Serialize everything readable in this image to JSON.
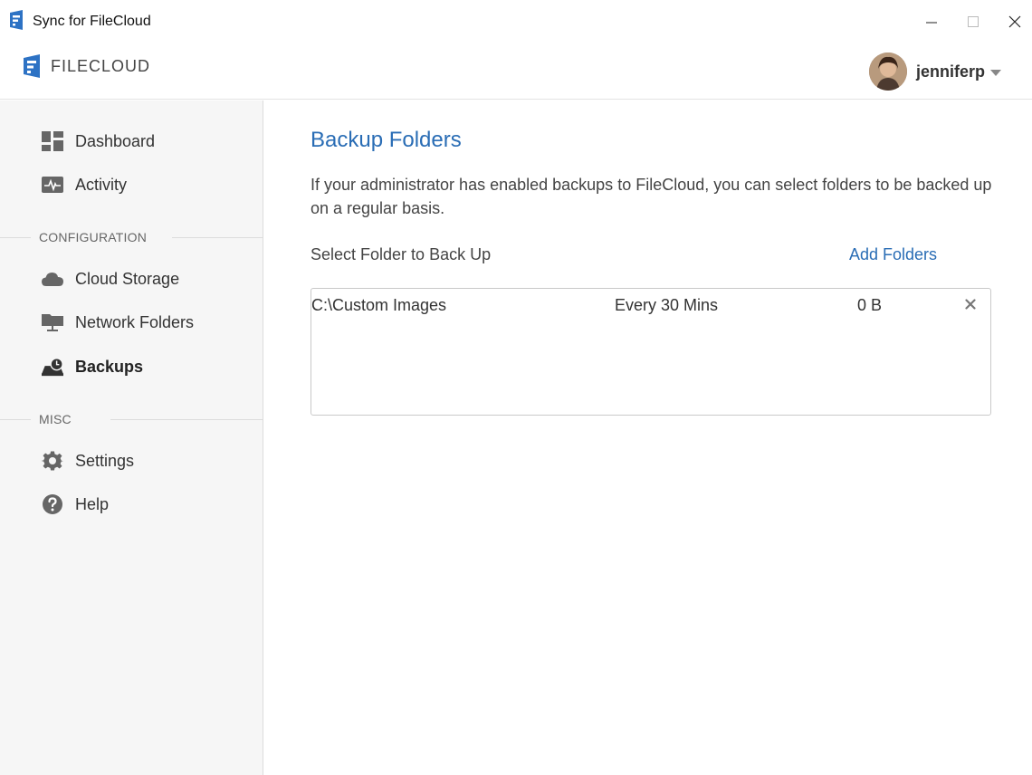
{
  "window": {
    "title": "Sync for FileCloud"
  },
  "header": {
    "brand_text": "FILECLOUD",
    "username": "jenniferp"
  },
  "sidebar": {
    "items": [
      {
        "label": "Dashboard",
        "icon": "dashboard-icon"
      },
      {
        "label": "Activity",
        "icon": "activity-icon"
      },
      {
        "label": "Cloud Storage",
        "icon": "cloud-icon"
      },
      {
        "label": "Network Folders",
        "icon": "network-folder-icon"
      },
      {
        "label": "Backups",
        "icon": "backup-icon",
        "active": true
      },
      {
        "label": "Settings",
        "icon": "gear-icon"
      },
      {
        "label": "Help",
        "icon": "help-icon"
      }
    ],
    "sections": {
      "configuration": "CONFIGURATION",
      "misc": "MISC"
    }
  },
  "main": {
    "title": "Backup Folders",
    "description": "If your administrator has enabled backups to FileCloud, you can select folders to be backed up on a regular basis.",
    "select_label": "Select Folder to Back Up",
    "add_folders_label": "Add Folders",
    "folders": [
      {
        "path": "C:\\Custom Images",
        "frequency": "Every 30 Mins",
        "size": "0 B"
      }
    ]
  },
  "colors": {
    "accent": "#2a6db5",
    "sidebar_bg": "#f6f6f6",
    "logo_blue": "#2d72c4"
  }
}
